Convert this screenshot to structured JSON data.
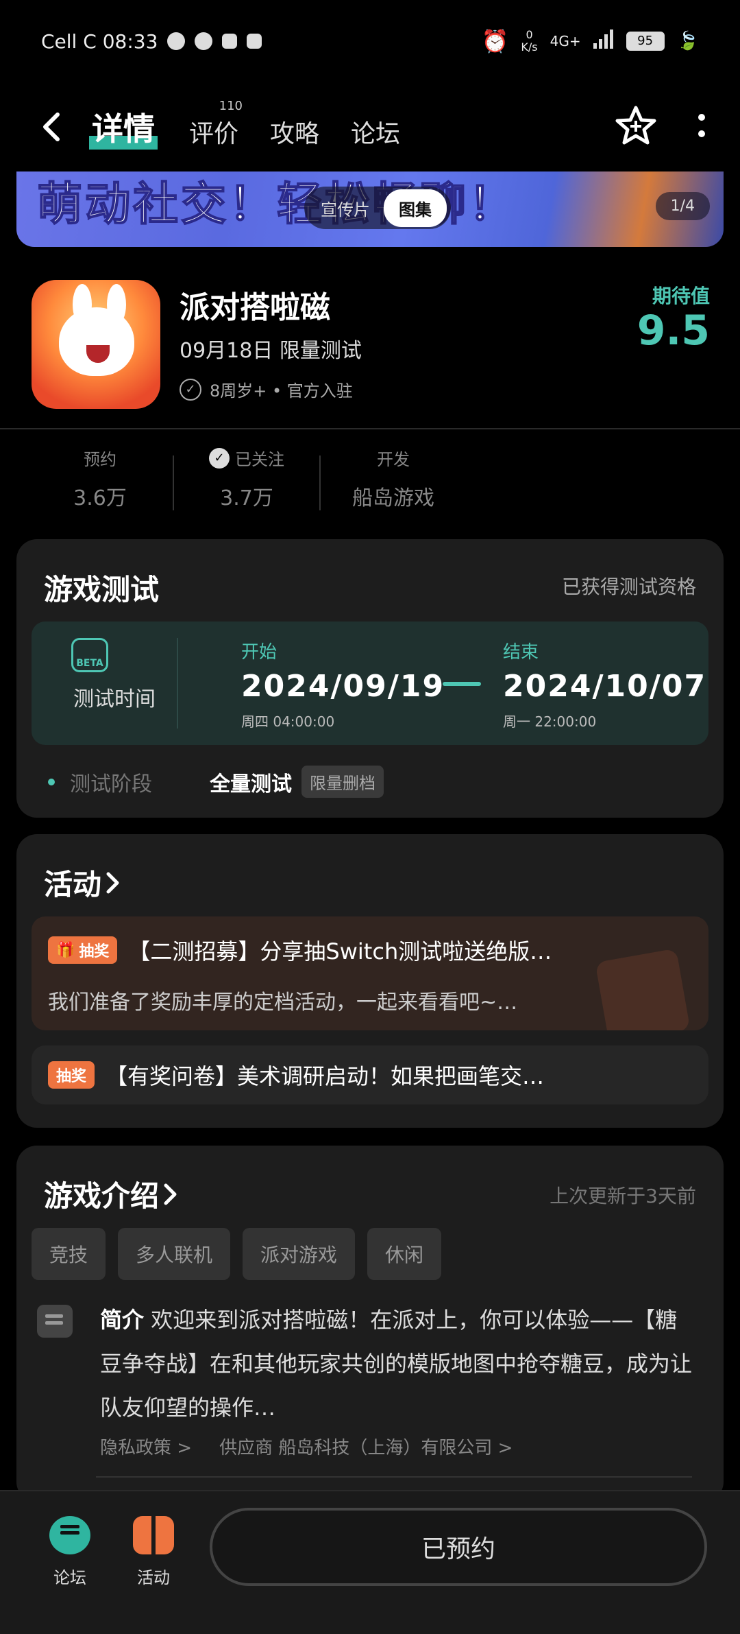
{
  "status_bar": {
    "carrier_time": "Cell C 08:33",
    "net_speed": "0\nK/s",
    "network": "4G+",
    "battery": "95"
  },
  "nav": {
    "tabs": [
      {
        "label": "详情"
      },
      {
        "label": "评价",
        "badge": "110"
      },
      {
        "label": "攻略"
      },
      {
        "label": "论坛"
      }
    ]
  },
  "banner": {
    "headline": "萌动社交！轻松畅聊！",
    "tab_video": "宣传片",
    "tab_gallery": "图集",
    "page": "1/4"
  },
  "game": {
    "title": "派对搭啦磁",
    "date_line": "09月18日 限量测试",
    "meta": "8周岁+ • 官方入驻",
    "expect_label": "期待值",
    "expect_value": "9.5"
  },
  "stats": [
    {
      "label": "预约",
      "value": "3.6万"
    },
    {
      "label": "已关注",
      "value": "3.7万"
    },
    {
      "label": "开发",
      "value": "船岛游戏"
    }
  ],
  "test": {
    "title": "游戏测试",
    "status": "已获得测试资格",
    "time_label": "测试时间",
    "start_label": "开始",
    "start_date": "2024/09/19",
    "start_time": "周四 04:00:00",
    "end_label": "结束",
    "end_date": "2024/10/07",
    "end_time": "周一 22:00:00",
    "scope_label": "测试阶段",
    "scope_value": "全量测试",
    "scope_tag": "限量删档"
  },
  "activity": {
    "title": "活动",
    "items": [
      {
        "tag": "抽奖",
        "title": "【二测招募】分享抽Switch测试啦送绝版…",
        "desc": "我们准备了奖励丰厚的定档活动，一起来看看吧~…"
      },
      {
        "tag": "抽奖",
        "title": "【有奖问卷】美术调研启动！如果把画笔交…"
      }
    ]
  },
  "intro": {
    "title": "游戏介绍",
    "updated": "上次更新于3天前",
    "tags": [
      "竞技",
      "多人联机",
      "派对游戏",
      "休闲"
    ],
    "summary_label": "简介",
    "summary": "欢迎来到派对搭啦磁！在派对上，你可以体验——【糖豆争夺战】在和其他玩家共创的模版地图中抢夺糖豆，成为让队友仰望的操作…",
    "privacy": "隐私政策 >",
    "provider": "供应商 船岛科技（上海）有限公司 >"
  },
  "bottom": {
    "forum": "论坛",
    "activity": "活动",
    "reserve": "已预约"
  },
  "colors": {
    "accent": "#4ec7b4",
    "lottery": "#ee7440",
    "card": "#1d1d1d"
  }
}
